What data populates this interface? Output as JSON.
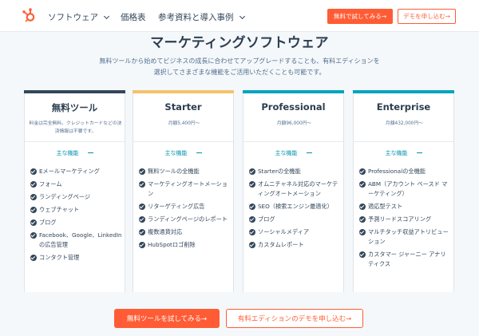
{
  "nav": {
    "items": [
      {
        "label": "ソフトウェア",
        "dropdown": true
      },
      {
        "label": "価格表",
        "dropdown": false
      },
      {
        "label": "参考資料と導入事例",
        "dropdown": true
      }
    ],
    "cta_primary": "無料で試してみる→",
    "cta_secondary": "デモを申し込む→",
    "logo_icon": "hubspot-sprocket-icon",
    "brand_color": "#ff5c35"
  },
  "main": {
    "heading": "マーケティングソフトウェア",
    "subtext_line1": "無料ツールから始めてビジネスの成長に合わせてアップグレードすることも、有料エディションを",
    "subtext_line2": "選択してさまざまな機能をご活用いただくことも可能です。"
  },
  "plans": [
    {
      "name": "無料ツール",
      "price": "料金は完全無料。クレジットカードなどの決済情報は不要です。",
      "features_label": "主な機能",
      "accent": "#33475b",
      "features": [
        "Eメールマーケティング",
        "フォーム",
        "ランディングページ",
        "ウェブチャット",
        "ブログ",
        "Facebook、Google、LinkedInの広告管理",
        "コンタクト管理"
      ]
    },
    {
      "name": "Starter",
      "price": "月額5,400円〜",
      "features_label": "主な機能",
      "accent": "#f5c26b",
      "features": [
        "無料ツールの全機能",
        "マーケティングオートメーション",
        "リターゲティング広告",
        "ランディングページのレポート",
        "複数通貨対応",
        "HubSpotロゴ削除"
      ]
    },
    {
      "name": "Professional",
      "price": "月額96,000円〜",
      "features_label": "主な機能",
      "accent": "#00a4bd",
      "features": [
        "Starterの全機能",
        "オムニチャネル対応のマーケティングオートメーション",
        "SEO（検索エンジン最適化）",
        "ブログ",
        "ソーシャルメディア",
        "カスタムレポート"
      ]
    },
    {
      "name": "Enterprise",
      "price": "月額432,000円〜",
      "features_label": "主な機能",
      "accent": "#00a4bd",
      "features": [
        "Professionalの全機能",
        "ABM（アカウント ベースド マーケティング）",
        "適応型テスト",
        "予測リードスコアリング",
        "マルチタッチ収益アトリビューション",
        "カスタマー ジャーニー アナリティクス"
      ]
    }
  ],
  "footer": {
    "cta_primary": "無料ツールを試してみる→",
    "cta_secondary": "有料エディションのデモを申し込む→"
  }
}
